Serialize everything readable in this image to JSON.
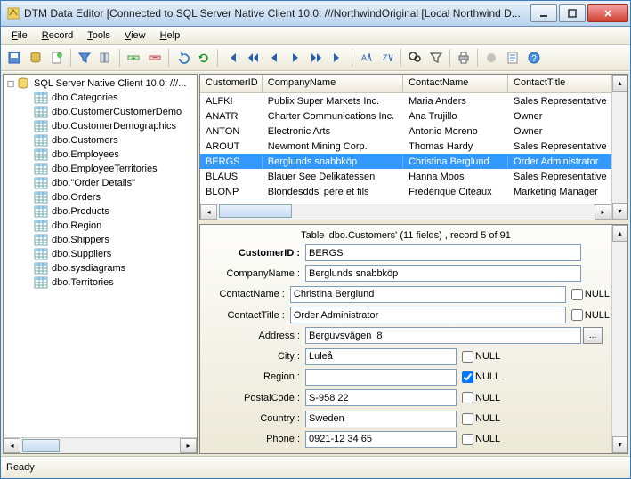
{
  "title": "DTM Data Editor [Connected to SQL Server Native Client 10.0: ///NorthwindOriginal [Local Northwind D...",
  "menu": [
    "File",
    "Record",
    "Tools",
    "View",
    "Help"
  ],
  "tree": {
    "root": "SQL Server Native Client 10.0: ///...",
    "items": [
      "dbo.Categories",
      "dbo.CustomerCustomerDemo",
      "dbo.CustomerDemographics",
      "dbo.Customers",
      "dbo.Employees",
      "dbo.EmployeeTerritories",
      "dbo.\"Order Details\"",
      "dbo.Orders",
      "dbo.Products",
      "dbo.Region",
      "dbo.Shippers",
      "dbo.Suppliers",
      "dbo.sysdiagrams",
      "dbo.Territories"
    ]
  },
  "grid": {
    "columns": [
      "CustomerID",
      "CompanyName",
      "ContactName",
      "ContactTitle"
    ],
    "rows": [
      {
        "c": [
          "ALFKI",
          "Publix Super Markets Inc.",
          "Maria Anders",
          "Sales Representative"
        ],
        "sel": false
      },
      {
        "c": [
          "ANATR",
          "Charter Communications Inc.",
          "Ana Trujillo",
          "Owner"
        ],
        "sel": false
      },
      {
        "c": [
          "ANTON",
          "Electronic Arts",
          "Antonio Moreno",
          "Owner"
        ],
        "sel": false
      },
      {
        "c": [
          "AROUT",
          "Newmont Mining Corp.",
          "Thomas Hardy",
          "Sales Representative"
        ],
        "sel": false
      },
      {
        "c": [
          "BERGS",
          "Berglunds snabbköp",
          "Christina Berglund",
          "Order Administrator"
        ],
        "sel": true
      },
      {
        "c": [
          "BLAUS",
          "Blauer See Delikatessen",
          "Hanna Moos",
          "Sales Representative"
        ],
        "sel": false
      },
      {
        "c": [
          "BLONP",
          "Blondesddsl père et fils",
          "Frédérique Citeaux",
          "Marketing Manager"
        ],
        "sel": false
      }
    ]
  },
  "form": {
    "header": "Table 'dbo.Customers' (11 fields) , record 5 of 91",
    "fields": [
      {
        "label": "CustomerID :",
        "value": "BERGS",
        "bold": true,
        "null": null,
        "wide": true
      },
      {
        "label": "CompanyName :",
        "value": "Berglunds snabbköp",
        "null": null,
        "wide": true
      },
      {
        "label": "ContactName :",
        "value": "Christina Berglund",
        "null": false,
        "wide": true
      },
      {
        "label": "ContactTitle :",
        "value": "Order Administrator",
        "null": false,
        "wide": true
      },
      {
        "label": "Address :",
        "value": "Berguvsvägen  8",
        "null": null,
        "wide": true,
        "extra": true
      },
      {
        "label": "City :",
        "value": "Luleå",
        "null": false,
        "narrow": true
      },
      {
        "label": "Region :",
        "value": "",
        "null": true,
        "narrow": true
      },
      {
        "label": "PostalCode :",
        "value": "S-958 22",
        "null": false,
        "narrow": true
      },
      {
        "label": "Country :",
        "value": "Sweden",
        "null": false,
        "narrow": true
      },
      {
        "label": "Phone :",
        "value": "0921-12 34 65",
        "null": false,
        "narrow": true
      }
    ],
    "null_label": "NULL"
  },
  "status": "Ready"
}
